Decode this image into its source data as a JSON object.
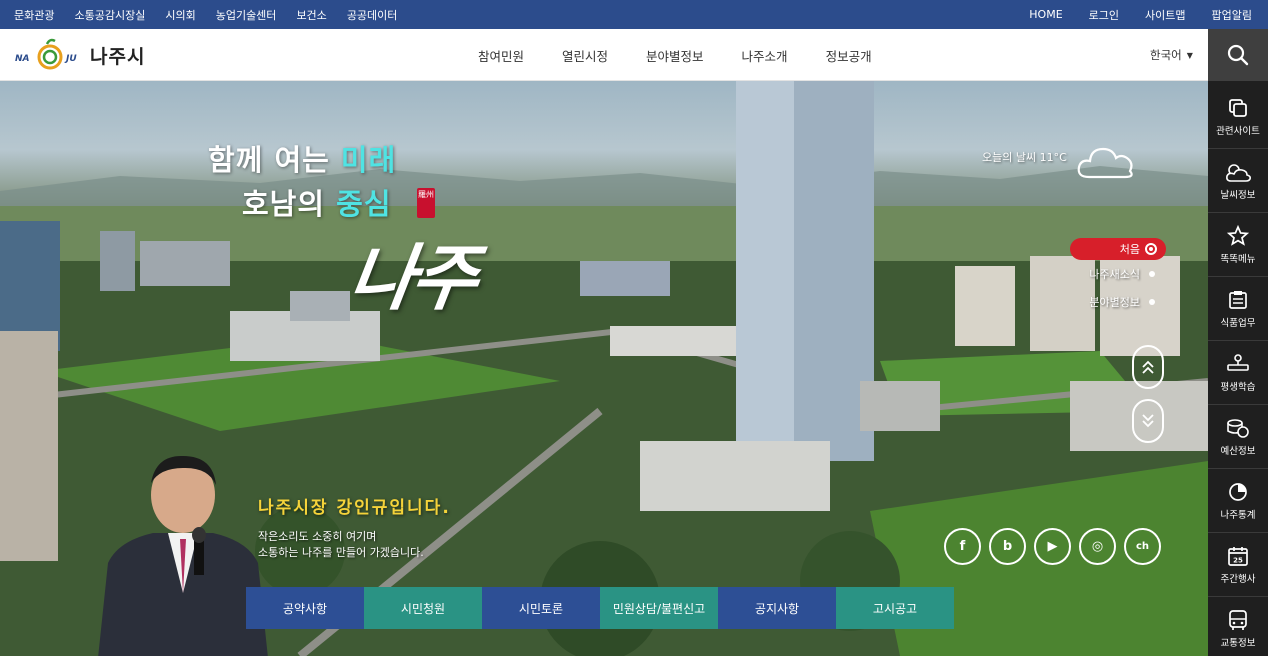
{
  "topbar": {
    "left_links": [
      "문화관광",
      "소통공감시장실",
      "시의회",
      "농업기술센터",
      "보건소",
      "공공데이터"
    ],
    "right_links": [
      "HOME",
      "로그인",
      "사이트맵",
      "팝업알림"
    ]
  },
  "header": {
    "logo_text": "나주시",
    "logo_sub_left": "NA",
    "logo_sub_right": "JU",
    "nav": [
      "참여민원",
      "열린시정",
      "분야별정보",
      "나주소개",
      "정보공개"
    ],
    "language": "한국어"
  },
  "hero": {
    "slogan_line1_prefix": "함께 여는 ",
    "slogan_line1_highlight": "미래",
    "slogan_line2_prefix": "호남의 ",
    "slogan_line2_highlight": "중심",
    "seal_text": "羅州",
    "script_name": "나주",
    "weather_text": "오늘의 날씨 11°C",
    "weather_icon": "cloud-icon",
    "slide_nav": {
      "active": "처음",
      "items": [
        "나주새소식",
        "분야별정보"
      ]
    },
    "mayor_title": "나주시장 강인규입니다.",
    "mayor_message_line1": "작은소리도 소중히 여기며",
    "mayor_message_line2": "소통하는 나주를 만들어 가겠습니다.",
    "sns": [
      {
        "name": "facebook-icon",
        "glyph": "f"
      },
      {
        "name": "blog-icon",
        "glyph": "b"
      },
      {
        "name": "youtube-icon",
        "glyph": "▶"
      },
      {
        "name": "instagram-icon",
        "glyph": "◎"
      },
      {
        "name": "kakao-icon",
        "glyph": "ch"
      }
    ],
    "quick_menu": [
      "공약사항",
      "시민청원",
      "시민토론",
      "민원상담/불편신고",
      "공지사항",
      "고시공고"
    ]
  },
  "sidebar": {
    "items": [
      "관련사이트",
      "날씨정보",
      "똑똑메뉴",
      "식품업무",
      "평생학습",
      "예산정보",
      "나주통계",
      "주간행사",
      "교통정보"
    ],
    "calendar_day": "25"
  },
  "colors": {
    "topbar": "#2c4c8c",
    "quick_blue": "#2d4f95",
    "quick_teal": "#2a9384",
    "slogan_highlight": "#4fe3e3",
    "active_red": "#d71f2a"
  }
}
